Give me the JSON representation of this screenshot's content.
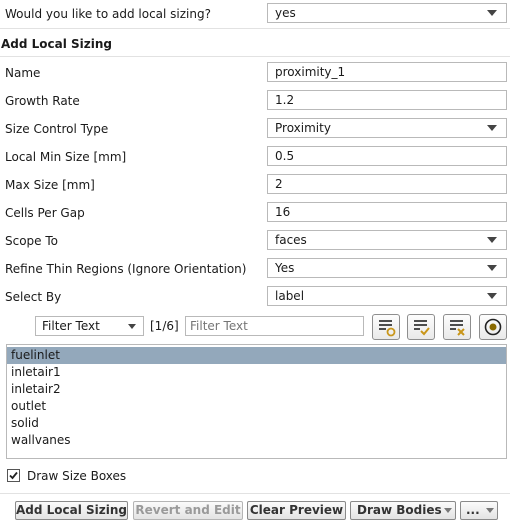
{
  "question": {
    "label": "Would you like to add local sizing?",
    "value": "yes"
  },
  "section_title": "Add Local Sizing",
  "fields": {
    "name": {
      "label": "Name",
      "value": "proximity_1"
    },
    "growth_rate": {
      "label": "Growth Rate",
      "value": "1.2"
    },
    "size_control_type": {
      "label": "Size Control Type",
      "value": "Proximity"
    },
    "local_min_size": {
      "label": "Local Min Size [mm]",
      "value": "0.5"
    },
    "max_size": {
      "label": "Max Size [mm]",
      "value": "2"
    },
    "cells_per_gap": {
      "label": "Cells Per Gap",
      "value": "16"
    },
    "scope_to": {
      "label": "Scope To",
      "value": "faces"
    },
    "refine_thin_regions": {
      "label": "Refine Thin Regions (Ignore Orientation)",
      "value": "Yes"
    },
    "select_by": {
      "label": "Select By",
      "value": "label"
    }
  },
  "filter": {
    "mode": "Filter Text",
    "count": "[1/6]",
    "placeholder": "Filter Text",
    "icons": [
      "select-all-icon",
      "check-list-icon",
      "clear-list-icon",
      "target-icon"
    ]
  },
  "list": {
    "items": [
      "fuelinlet",
      "inletair1",
      "inletair2",
      "outlet",
      "solid",
      "wallvanes"
    ],
    "selected_index": 0
  },
  "draw_size_boxes": {
    "label": "Draw Size Boxes",
    "checked": true
  },
  "buttons": {
    "add": "Add Local Sizing",
    "revert": "Revert and Edit",
    "clear_preview": "Clear Preview",
    "draw_bodies": "Draw Bodies",
    "more": "..."
  },
  "colors": {
    "selection": "#93a8bb",
    "border": "#b9b9b9",
    "target_icon": "#8a6a00"
  }
}
